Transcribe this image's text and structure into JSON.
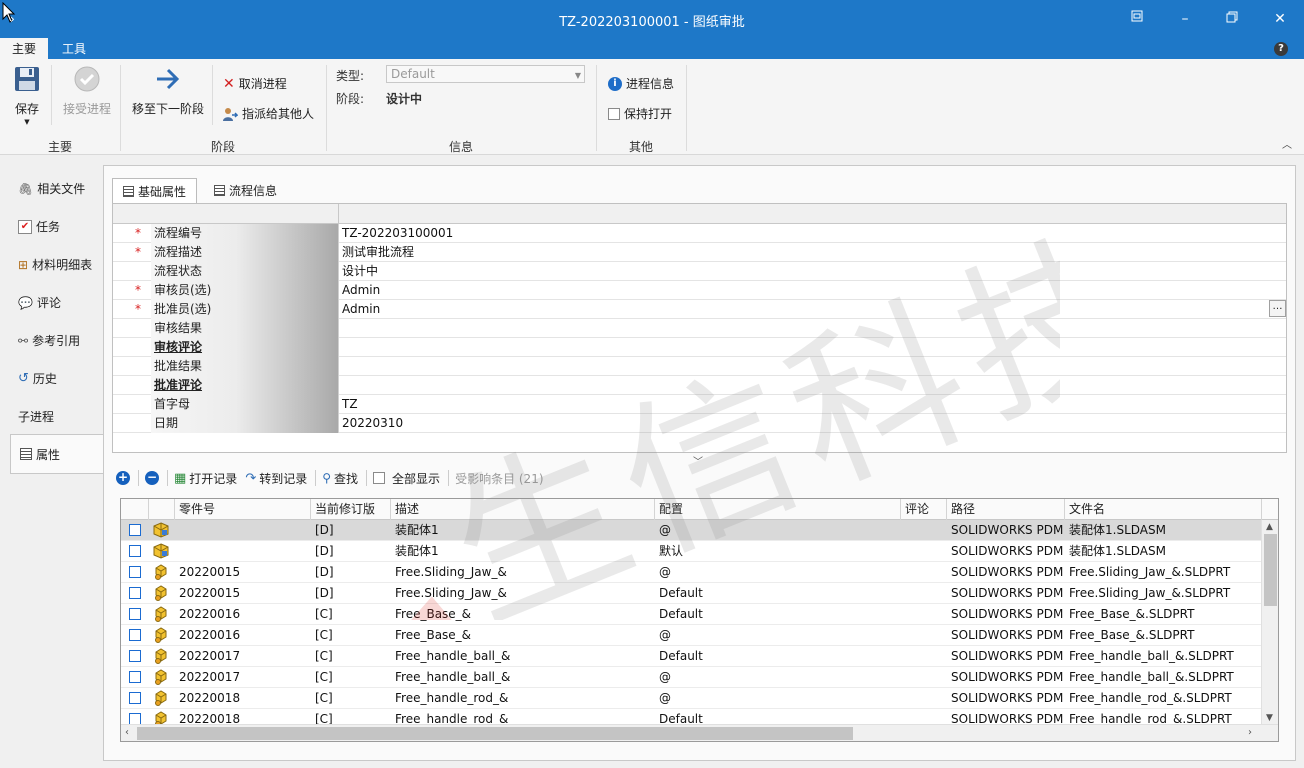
{
  "window": {
    "title": "TZ-202203100001 - 图纸审批"
  },
  "ribbon": {
    "tabs": [
      "主要",
      "工具"
    ],
    "groups": {
      "main": "主要",
      "stage": "阶段",
      "info": "信息",
      "other": "其他"
    },
    "save_label": "保存",
    "accept_label": "接受进程",
    "move_next_label": "移至下一阶段",
    "cancel_label": "取消进程",
    "assign_label": "指派给其他人",
    "type_label": "类型:",
    "type_value": "Default",
    "stage_label": "阶段:",
    "stage_value": "设计中",
    "process_info_label": "进程信息",
    "keep_open_label": "保持打开"
  },
  "leftnav": {
    "items": [
      "相关文件",
      "任务",
      "材料明细表",
      "评论",
      "参考引用",
      "历史",
      "子进程",
      "属性"
    ]
  },
  "property_tabs": [
    "基础属性",
    "流程信息"
  ],
  "properties": [
    {
      "key": "流程编号",
      "value": "TZ-202203100001",
      "required": true,
      "link": false
    },
    {
      "key": "流程描述",
      "value": "测试审批流程",
      "required": true,
      "link": false
    },
    {
      "key": "流程状态",
      "value": "设计中",
      "required": false,
      "link": false
    },
    {
      "key": "审核员(选)",
      "value": "Admin",
      "required": true,
      "link": false
    },
    {
      "key": "批准员(选)",
      "value": "Admin",
      "required": true,
      "link": false
    },
    {
      "key": "审核结果",
      "value": "",
      "required": false,
      "link": false
    },
    {
      "key": "审核评论",
      "value": "",
      "required": false,
      "link": true
    },
    {
      "key": "批准结果",
      "value": "",
      "required": false,
      "link": false
    },
    {
      "key": "批准评论",
      "value": "",
      "required": false,
      "link": true
    },
    {
      "key": "首字母",
      "value": "TZ",
      "required": false,
      "link": false
    },
    {
      "key": "日期",
      "value": "20220310",
      "required": false,
      "link": false
    }
  ],
  "toolbar": {
    "open_record": "打开记录",
    "goto_record": "转到记录",
    "find": "查找",
    "show_all": "全部显示",
    "affected_items": "受影响条目 (21)"
  },
  "grid": {
    "columns": [
      "零件号",
      "当前修订版",
      "描述",
      "配置",
      "评论",
      "路径",
      "文件名"
    ],
    "rows": [
      {
        "icon": "assembly",
        "part": "",
        "rev": "[D]",
        "desc": "装配体1",
        "config": "@",
        "comment": "",
        "path": "SOLIDWORKS PDM",
        "file": "装配体1.SLDASM",
        "selected": true
      },
      {
        "icon": "assembly",
        "part": "",
        "rev": "[D]",
        "desc": "装配体1",
        "config": "默认",
        "comment": "",
        "path": "SOLIDWORKS PDM",
        "file": "装配体1.SLDASM",
        "selected": false
      },
      {
        "icon": "part",
        "part": "20220015",
        "rev": "[D]",
        "desc": "Free.Sliding_Jaw_&",
        "config": "@",
        "comment": "",
        "path": "SOLIDWORKS PDM",
        "file": "Free.Sliding_Jaw_&.SLDPRT",
        "selected": false
      },
      {
        "icon": "part",
        "part": "20220015",
        "rev": "[D]",
        "desc": "Free.Sliding_Jaw_&",
        "config": "Default",
        "comment": "",
        "path": "SOLIDWORKS PDM",
        "file": "Free.Sliding_Jaw_&.SLDPRT",
        "selected": false
      },
      {
        "icon": "part",
        "part": "20220016",
        "rev": "[C]",
        "desc": "Free_Base_&",
        "config": "Default",
        "comment": "",
        "path": "SOLIDWORKS PDM",
        "file": "Free_Base_&.SLDPRT",
        "selected": false
      },
      {
        "icon": "part",
        "part": "20220016",
        "rev": "[C]",
        "desc": "Free_Base_&",
        "config": "@",
        "comment": "",
        "path": "SOLIDWORKS PDM",
        "file": "Free_Base_&.SLDPRT",
        "selected": false
      },
      {
        "icon": "part",
        "part": "20220017",
        "rev": "[C]",
        "desc": "Free_handle_ball_&",
        "config": "Default",
        "comment": "",
        "path": "SOLIDWORKS PDM",
        "file": "Free_handle_ball_&.SLDPRT",
        "selected": false
      },
      {
        "icon": "part",
        "part": "20220017",
        "rev": "[C]",
        "desc": "Free_handle_ball_&",
        "config": "@",
        "comment": "",
        "path": "SOLIDWORKS PDM",
        "file": "Free_handle_ball_&.SLDPRT",
        "selected": false
      },
      {
        "icon": "part",
        "part": "20220018",
        "rev": "[C]",
        "desc": "Free_handle_rod_&",
        "config": "@",
        "comment": "",
        "path": "SOLIDWORKS PDM",
        "file": "Free_handle_rod_&.SLDPRT",
        "selected": false
      },
      {
        "icon": "part",
        "part": "20220018",
        "rev": "[C]",
        "desc": "Free_handle_rod_&",
        "config": "Default",
        "comment": "",
        "path": "SOLIDWORKS PDM",
        "file": "Free_handle_rod_&.SLDPRT",
        "selected": false
      }
    ]
  },
  "watermark": "生信科技",
  "colors": {
    "titlebar": "#1e78c8",
    "required": "#d81e1e",
    "checkbox_border": "#1b6bd1"
  }
}
